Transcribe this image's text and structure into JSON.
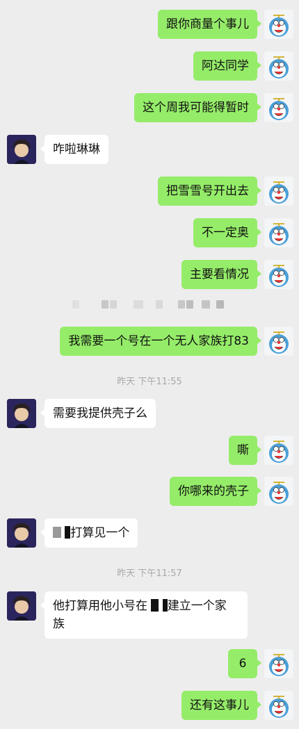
{
  "messages": [
    {
      "from": "me",
      "text": "跟你商量个事儿"
    },
    {
      "from": "me",
      "text": "阿达同学"
    },
    {
      "from": "me",
      "text": "这个周我可能得暂时"
    },
    {
      "from": "them",
      "text": "咋啦琳琳"
    },
    {
      "from": "me",
      "text": "把雪雪号开出去"
    },
    {
      "from": "me",
      "text": "不一定奥"
    },
    {
      "from": "me",
      "text": "主要看情况"
    },
    {
      "from": "me",
      "text": "我需要一个号在一个无人家族打83"
    },
    {
      "from": "them",
      "text": "需要我提供壳子么"
    },
    {
      "from": "me",
      "text": "嘶"
    },
    {
      "from": "me",
      "text": "你哪来的壳子"
    },
    {
      "from": "them",
      "text_after_redaction": "打算见一个"
    },
    {
      "from": "them",
      "text_before_redaction": "他打算用他小号在",
      "text_after_redaction": "建立一个家",
      "text_line2": "族"
    },
    {
      "from": "me",
      "text": "6"
    },
    {
      "from": "me",
      "text": "还有这事儿"
    }
  ],
  "timestamps": [
    "昨天 下午11:55",
    "昨天 下午11:57"
  ],
  "avatars": {
    "me": "doraemon-avatar-icon",
    "them": "anime-boy-avatar-icon"
  },
  "colors": {
    "background": "#ededed",
    "my_bubble": "#95ec69",
    "their_bubble": "#ffffff"
  }
}
